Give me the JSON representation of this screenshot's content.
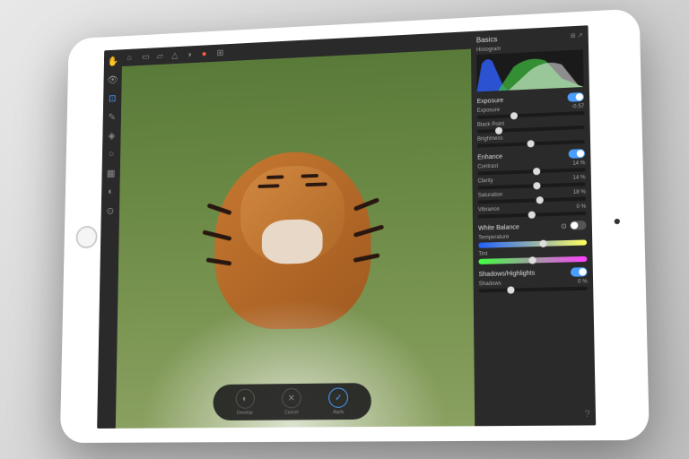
{
  "panel": {
    "title": "Basics",
    "histogram_label": "Histogram"
  },
  "exposure": {
    "title": "Exposure",
    "enabled": true,
    "controls": {
      "exposure": {
        "label": "Exposure",
        "value": "-0.57",
        "pos": 35
      },
      "black_point": {
        "label": "Black Point",
        "value": "",
        "pos": 20
      },
      "brightness": {
        "label": "Brightness",
        "value": "",
        "pos": 50
      }
    }
  },
  "enhance": {
    "title": "Enhance",
    "enabled": true,
    "controls": {
      "contrast": {
        "label": "Contrast",
        "value": "14 %",
        "pos": 55
      },
      "clarity": {
        "label": "Clarity",
        "value": "14 %",
        "pos": 55
      },
      "saturation": {
        "label": "Saturation",
        "value": "18 %",
        "pos": 58
      },
      "vibrance": {
        "label": "Vibrance",
        "value": "0 %",
        "pos": 50
      }
    }
  },
  "white_balance": {
    "title": "White Balance",
    "enabled": false,
    "controls": {
      "temperature": {
        "label": "Temperature",
        "pos": 60
      },
      "tint": {
        "label": "Tint",
        "pos": 50
      }
    }
  },
  "shadows_highlights": {
    "title": "Shadows/Highlights",
    "enabled": true,
    "controls": {
      "shadows": {
        "label": "Shadows",
        "value": "0 %",
        "pos": 30
      }
    }
  },
  "bottom": {
    "develop": "Develop",
    "cancel": "Cancel",
    "apply": "Apply"
  }
}
